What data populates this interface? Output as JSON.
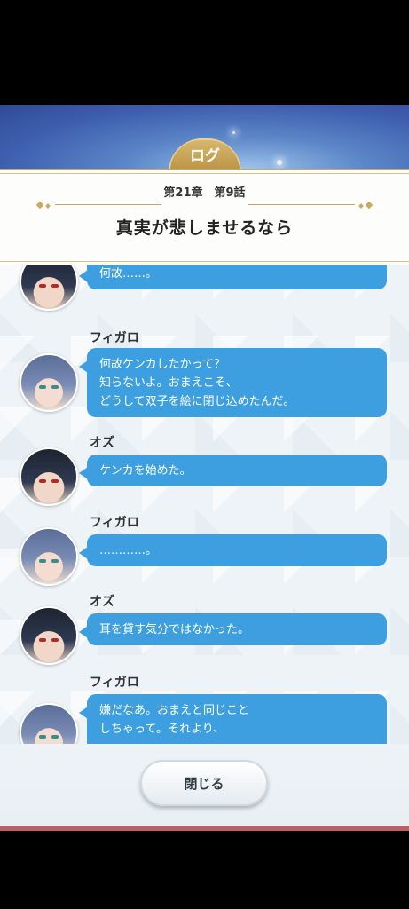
{
  "header": {
    "tab_label": "ログ",
    "chapter_line": "第21章　第9話",
    "episode_title": "真実が悲しませるなら"
  },
  "entries": [
    {
      "speaker": "",
      "character": "oz",
      "text": "何故……。"
    },
    {
      "speaker": "フィガロ",
      "character": "figaro",
      "text": "何故ケンカしたかって？\n知らないよ。おまえこそ、\nどうして双子を絵に閉じ込めたんだ。"
    },
    {
      "speaker": "オズ",
      "character": "oz",
      "text": "ケンカを始めた。"
    },
    {
      "speaker": "フィガロ",
      "character": "figaro",
      "text": "…………。"
    },
    {
      "speaker": "オズ",
      "character": "oz",
      "text": "耳を貸す気分ではなかった。"
    },
    {
      "speaker": "フィガロ",
      "character": "figaro",
      "text": "嫌だなあ。おまえと同じこと\nしちゃって。それより、"
    }
  ],
  "footer": {
    "close_label": "閉じる"
  },
  "colors": {
    "bubble": "#3d9fe0",
    "gold": "#c9a861",
    "banner": "#3e5fae"
  }
}
